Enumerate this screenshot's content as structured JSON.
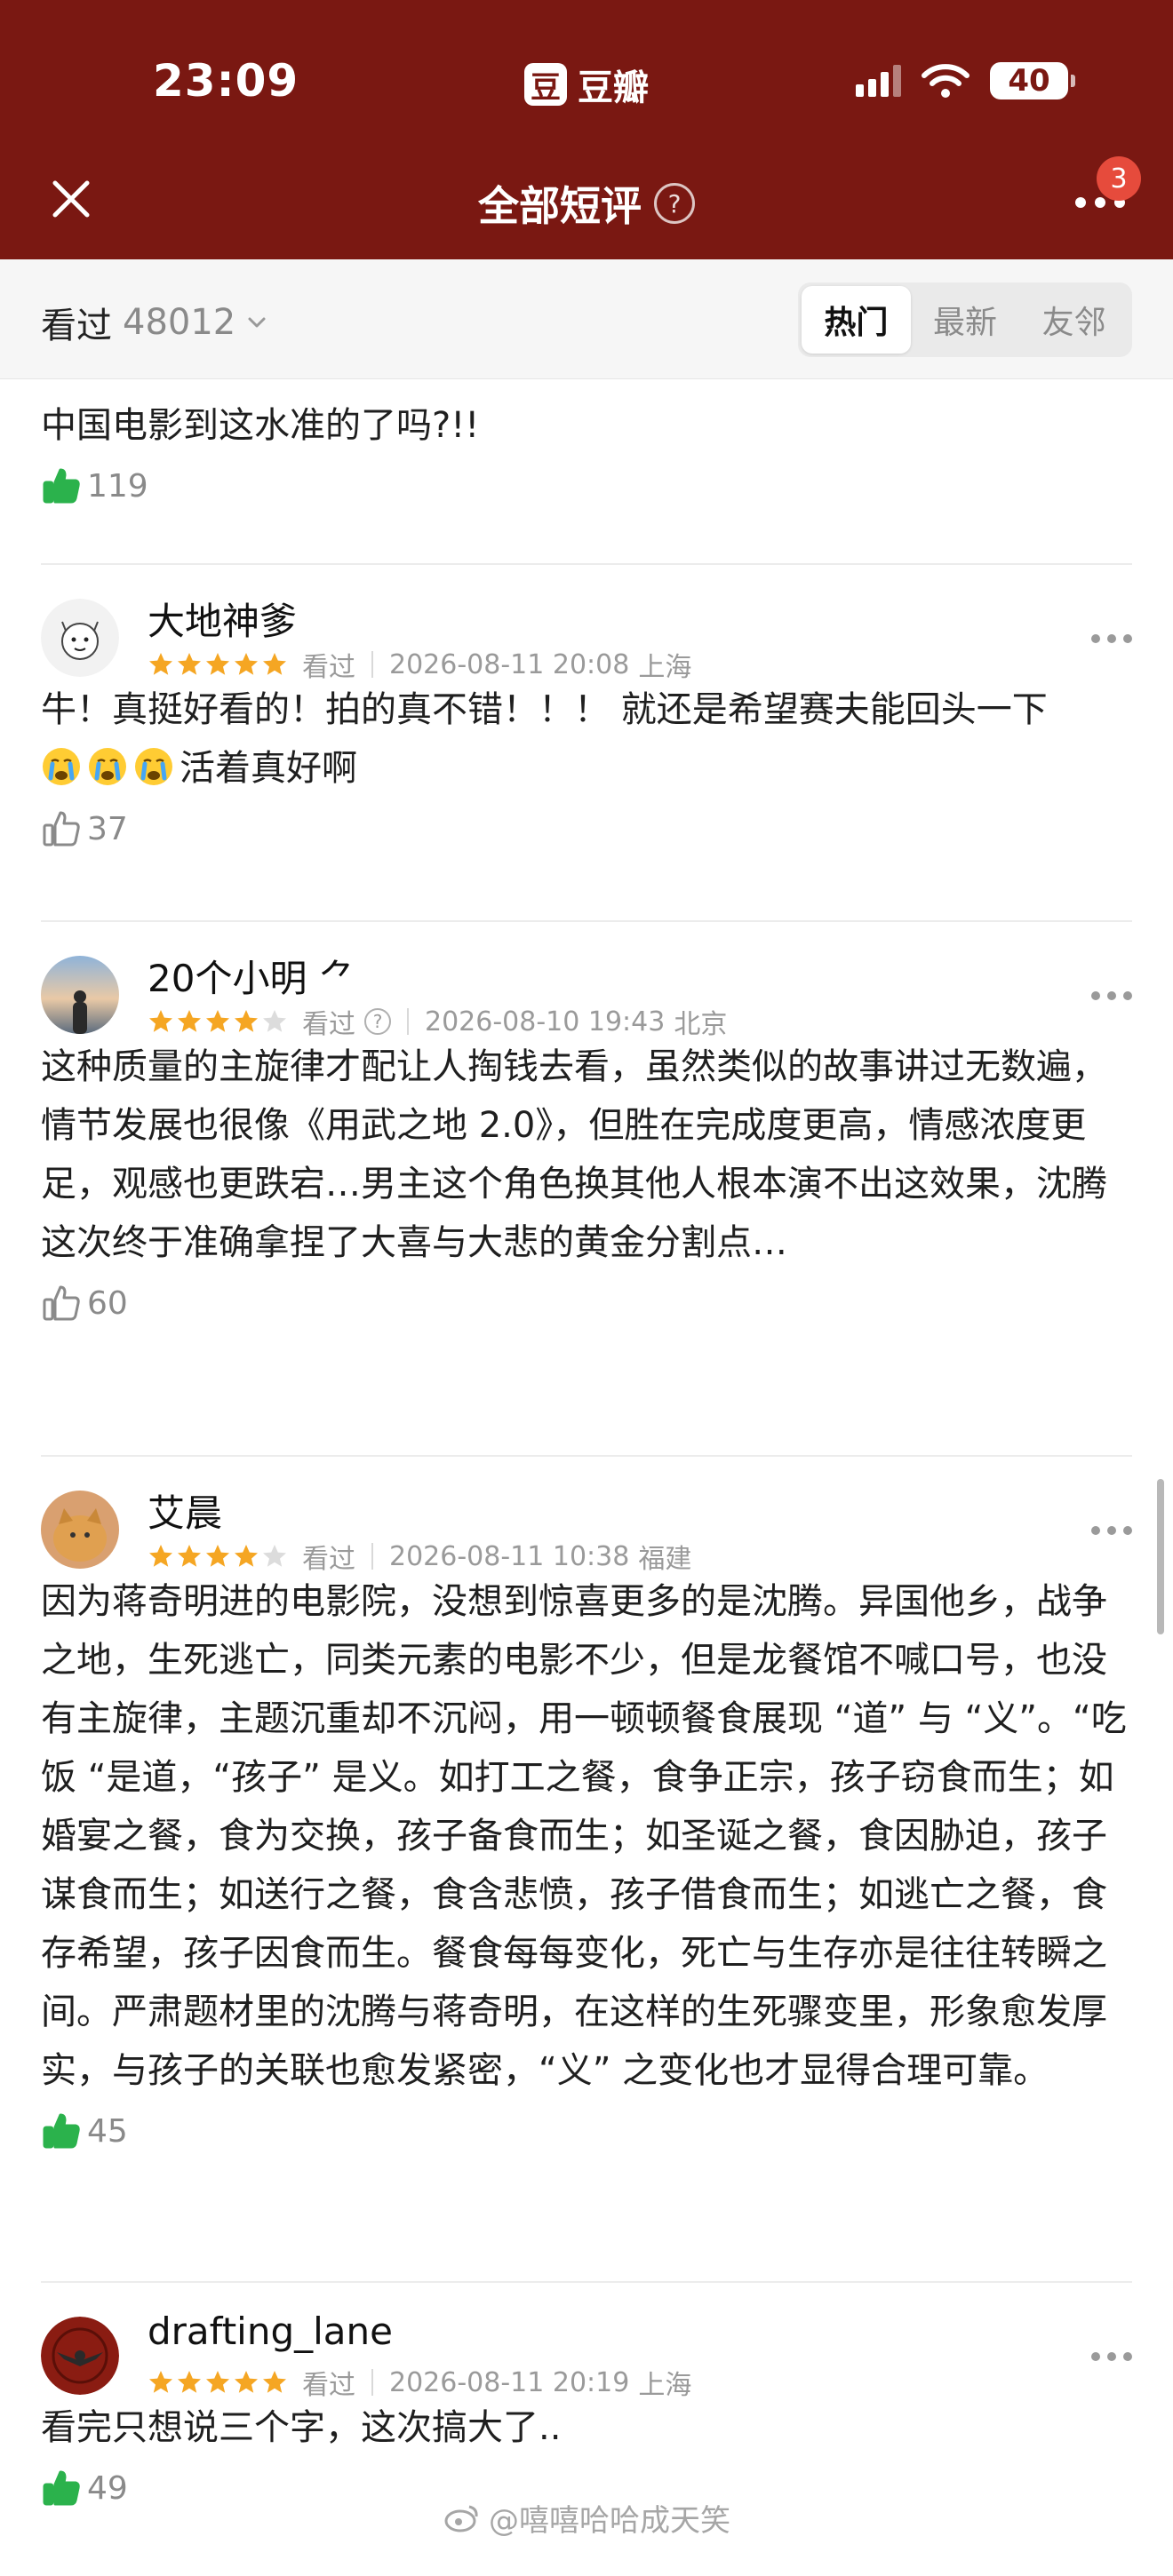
{
  "status": {
    "time": "23:09",
    "app_name": "豆瓣",
    "app_logo_char": "豆",
    "battery": "40"
  },
  "nav": {
    "title": "全部短评",
    "help": "?",
    "badge": "3"
  },
  "filter": {
    "label": "看过",
    "count": "48012",
    "tabs": [
      {
        "label": "热门",
        "active": true
      },
      {
        "label": "最新"
      },
      {
        "label": "友邻"
      }
    ]
  },
  "comments": [
    {
      "text": "中国电影到这水准的了吗?!!",
      "likes": "119",
      "liked": true
    },
    {
      "user": "大地神爹",
      "rating": 5,
      "status": "看过",
      "date": "2026-08-11 20:08",
      "location": "上海",
      "text_a": "牛！真挺好看的！拍的真不错！！！ 就还是希望赛夫能回头一下",
      "text_b": "活着真好啊",
      "likes": "37",
      "liked": false
    },
    {
      "user": "20个小明 ⺈",
      "rating": 4,
      "status": "看过",
      "help": "?",
      "date": "2026-08-10 19:43",
      "location": "北京",
      "text": "这种质量的主旋律才配让人掏钱去看，虽然类似的故事讲过无数遍，情节发展也很像《用武之地 2.0》，但胜在完成度更高，情感浓度更足，观感也更跌宕…男主这个角色换其他人根本演不出这效果，沈腾这次终于准确拿捏了大喜与大悲的黄金分割点…",
      "likes": "60",
      "liked": false
    },
    {
      "user": "艾晨",
      "rating": 4,
      "status": "看过",
      "date": "2026-08-11 10:38",
      "location": "福建",
      "text": "因为蒋奇明进的电影院，没想到惊喜更多的是沈腾。异国他乡，战争之地，生死逃亡，同类元素的电影不少，但是龙餐馆不喊口号，也没有主旋律，主题沉重却不沉闷，用一顿顿餐食展现 “道” 与 “义”。“吃饭 “是道，“孩子” 是义。如打工之餐，食争正宗，孩子窃食而生；如婚宴之餐，食为交换，孩子备食而生；如圣诞之餐，食因胁迫，孩子谋食而生；如送行之餐，食含悲愤，孩子借食而生；如逃亡之餐，食存希望，孩子因食而生。餐食每每变化，死亡与生存亦是往往转瞬之间。严肃题材里的沈腾与蒋奇明，在这样的生死骤变里，形象愈发厚实，与孩子的关联也愈发紧密，“义” 之变化也才显得合理可靠。",
      "likes": "45",
      "liked": true
    },
    {
      "user": "drafting_lane",
      "rating": 5,
      "status": "看过",
      "date": "2026-08-11 20:19",
      "location": "上海",
      "text": "看完只想说三个字，这次搞大了..",
      "likes": "49",
      "liked": true
    }
  ],
  "watermark": "@嘻嘻哈哈成天笑",
  "colors": {
    "header": "#7a1812",
    "star": "#f5a623",
    "like_active": "#2bb24c",
    "badge": "#e64b3c"
  }
}
